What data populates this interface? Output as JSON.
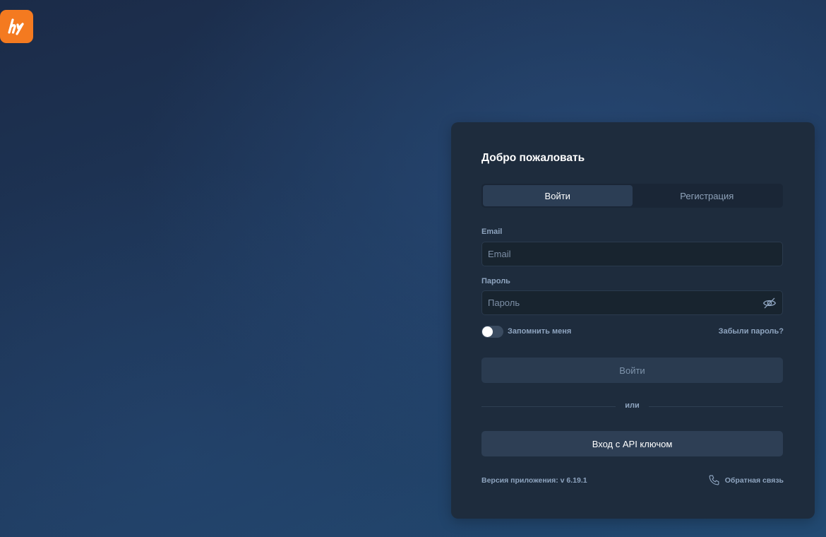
{
  "brand": {
    "logo_icon": "brand-logo-icon",
    "color": "#f47a20"
  },
  "login": {
    "title": "Добро пожаловать",
    "tabs": [
      {
        "label": "Войти",
        "active": true
      },
      {
        "label": "Регистрация",
        "active": false
      }
    ],
    "email": {
      "label": "Email",
      "placeholder": "Email",
      "value": ""
    },
    "password": {
      "label": "Пароль",
      "placeholder": "Пароль",
      "value": "",
      "toggle_icon": "eye-off-icon"
    },
    "remember": {
      "label": "Запомнить меня",
      "checked": false
    },
    "forgot_link": "Забыли пароль?",
    "submit_label": "Войти",
    "or_text": "или",
    "api_button_label": "Вход с API ключом",
    "version_text": "Версия приложения: v 6.19.1",
    "feedback": {
      "label": "Обратная связь",
      "icon": "phone-icon"
    }
  },
  "colors": {
    "card_bg": "#1e2c3d",
    "tab_active_bg": "#2c3e55",
    "muted_text": "#8ea4bf"
  }
}
